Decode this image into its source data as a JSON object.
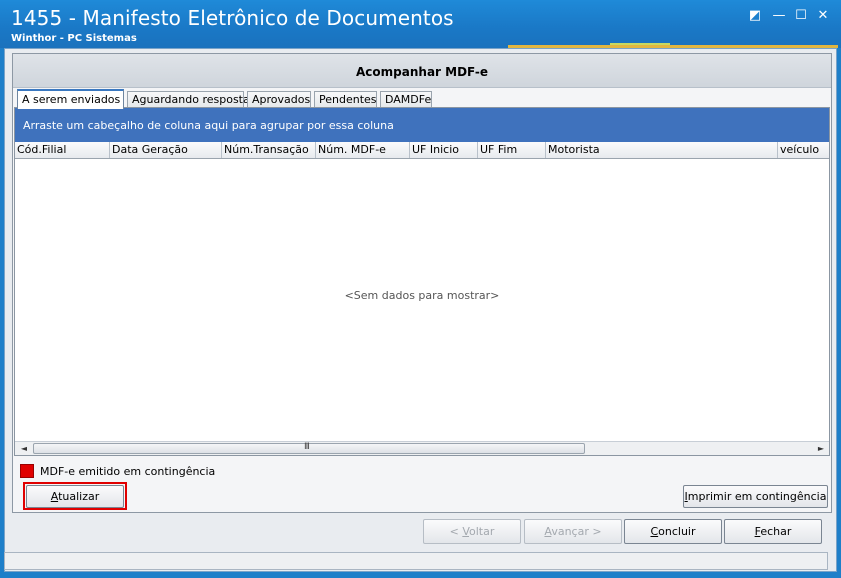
{
  "window": {
    "title": "1455 - Manifesto Eletrônico de Documentos",
    "subtitle": "Winthor - PC Sistemas",
    "controls": {
      "restore": "◩",
      "minimize": "—",
      "maximize": "☐",
      "close": "✕"
    }
  },
  "panel": {
    "title": "Acompanhar MDF-e"
  },
  "tabs": [
    {
      "label": "A serem enviados",
      "active": true
    },
    {
      "label": "Aguardando resposta",
      "active": false
    },
    {
      "label": "Aprovados",
      "active": false
    },
    {
      "label": "Pendentes",
      "active": false
    },
    {
      "label": "DAMDFe",
      "active": false
    }
  ],
  "grid": {
    "group_hint": "Arraste um cabeçalho de coluna aqui para agrupar por essa coluna",
    "columns": [
      "Cód.Filial",
      "Data Geração",
      "Núm.Transação",
      "Núm. MDF-e",
      "UF Inicio",
      "UF Fim",
      "Motorista",
      "veículo"
    ],
    "empty_message": "<Sem dados para mostrar>",
    "scroll": {
      "left": "◄",
      "right": "►",
      "grip": "III"
    }
  },
  "legend": {
    "label": "MDF-e emitido em contingência",
    "color": "#e00000"
  },
  "buttons": {
    "atualizar": {
      "pre": "",
      "key": "A",
      "post": "tualizar"
    },
    "imprimir": {
      "pre": "",
      "key": "I",
      "post": "mprimir em contingência"
    },
    "voltar": {
      "pre": "< ",
      "key": "V",
      "post": "oltar"
    },
    "avancar": {
      "pre": "",
      "key": "A",
      "post": "vançar >"
    },
    "concluir": {
      "pre": "",
      "key": "C",
      "post": "oncluir"
    },
    "fechar": {
      "pre": "",
      "key": "F",
      "post": "echar"
    }
  }
}
